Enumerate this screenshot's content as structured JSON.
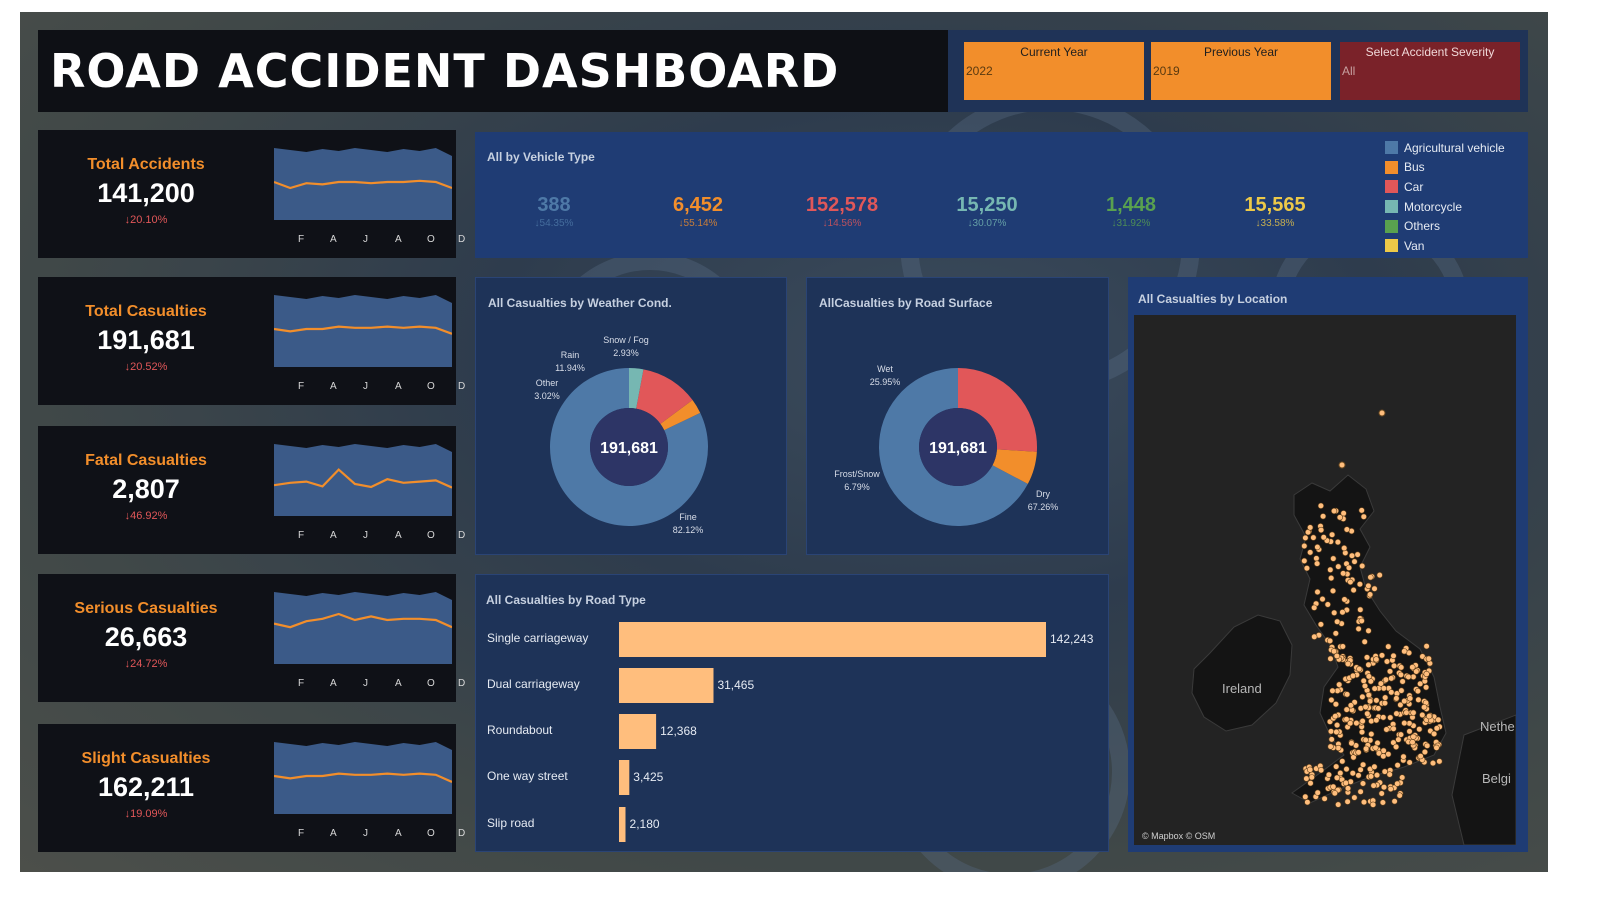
{
  "header": {
    "title": "ROAD ACCIDENT DASHBOARD",
    "filters": [
      {
        "label": "Current Year",
        "value": "2022"
      },
      {
        "label": "Previous Year",
        "value": "2019"
      },
      {
        "label": "Select Accident Severity",
        "value": "All"
      }
    ]
  },
  "kpis": [
    {
      "name": "Total Accidents",
      "value": "141,200",
      "delta": "↓20.10%",
      "trend": [
        0.3,
        0.2,
        0.28,
        0.26,
        0.3,
        0.3,
        0.28,
        0.3,
        0.3,
        0.32,
        0.3,
        0.2
      ]
    },
    {
      "name": "Total Casualties",
      "value": "191,681",
      "delta": "↓20.52%",
      "trend": [
        0.3,
        0.26,
        0.3,
        0.3,
        0.34,
        0.32,
        0.32,
        0.34,
        0.32,
        0.34,
        0.32,
        0.22
      ]
    },
    {
      "name": "Fatal Casualties",
      "value": "2,807",
      "delta": "↓46.92%",
      "trend": [
        0.18,
        0.22,
        0.24,
        0.16,
        0.44,
        0.2,
        0.15,
        0.28,
        0.22,
        0.24,
        0.26,
        0.14
      ]
    },
    {
      "name": "Serious Casualties",
      "value": "26,663",
      "delta": "↓24.72%",
      "trend": [
        0.34,
        0.28,
        0.38,
        0.42,
        0.5,
        0.4,
        0.46,
        0.4,
        0.42,
        0.42,
        0.4,
        0.28
      ]
    },
    {
      "name": "Slight Casualties",
      "value": "162,211",
      "delta": "↓19.09%",
      "trend": [
        0.3,
        0.26,
        0.3,
        0.3,
        0.34,
        0.32,
        0.32,
        0.34,
        0.32,
        0.34,
        0.32,
        0.2
      ]
    }
  ],
  "month_labels": [
    "F",
    "A",
    "J",
    "A",
    "O",
    "D"
  ],
  "vehicle": {
    "title": "All by Vehicle Type",
    "items": [
      {
        "name": "Agricultural vehicle",
        "value": "388",
        "delta": "↓54.35%",
        "color": "#4e79a7"
      },
      {
        "name": "Bus",
        "value": "6,452",
        "delta": "↓55.14%",
        "color": "#f28e2b"
      },
      {
        "name": "Car",
        "value": "152,578",
        "delta": "↓14.56%",
        "color": "#e15759"
      },
      {
        "name": "Motorcycle",
        "value": "15,250",
        "delta": "↓30.07%",
        "color": "#76b7b2"
      },
      {
        "name": "Others",
        "value": "1,448",
        "delta": "↓31.92%",
        "color": "#59a14f"
      },
      {
        "name": "Van",
        "value": "15,565",
        "delta": "↓33.58%",
        "color": "#edc948"
      }
    ]
  },
  "weather": {
    "title": "All Casualties by Weather Cond.",
    "center": "191,681"
  },
  "surface": {
    "title": "AllCasualties by Road Surface",
    "center": "191,681"
  },
  "roadtype": {
    "title": "All Casualties by Road Type"
  },
  "location": {
    "title": "All Casualties by Location",
    "label_ireland": "Ireland",
    "label_neth": "Nethe",
    "label_belg": "Belgi",
    "credit": "© Mapbox © OSM"
  },
  "chart_data": [
    {
      "type": "pie",
      "title": "All Casualties by Weather Cond.",
      "center_label": "191,681",
      "slices": [
        {
          "label": "Fine",
          "percent": "82.12%",
          "value": 82.12,
          "color": "#4e79a7"
        },
        {
          "label": "Other",
          "percent": "3.02%",
          "value": 3.02,
          "color": "#f28e2b"
        },
        {
          "label": "Rain",
          "percent": "11.94%",
          "value": 11.94,
          "color": "#e15759"
        },
        {
          "label": "Snow / Fog",
          "percent": "2.93%",
          "value": 2.93,
          "color": "#76b7b2"
        }
      ]
    },
    {
      "type": "pie",
      "title": "AllCasualties by Road Surface",
      "center_label": "191,681",
      "slices": [
        {
          "label": "Dry",
          "percent": "67.26%",
          "value": 67.26,
          "color": "#4e79a7"
        },
        {
          "label": "Frost/Snow",
          "percent": "6.79%",
          "value": 6.79,
          "color": "#f28e2b"
        },
        {
          "label": "Wet",
          "percent": "25.95%",
          "value": 25.95,
          "color": "#e15759"
        }
      ]
    },
    {
      "type": "bar",
      "orientation": "horizontal",
      "title": "All Casualties by Road Type",
      "categories": [
        "Single carriageway",
        "Dual carriageway",
        "Roundabout",
        "One way street",
        "Slip road"
      ],
      "values": [
        142243,
        31465,
        12368,
        3425,
        2180
      ],
      "value_labels": [
        "142,243",
        "31,465",
        "12,368",
        "3,425",
        "2,180"
      ],
      "color": "#ffbe7d"
    }
  ]
}
